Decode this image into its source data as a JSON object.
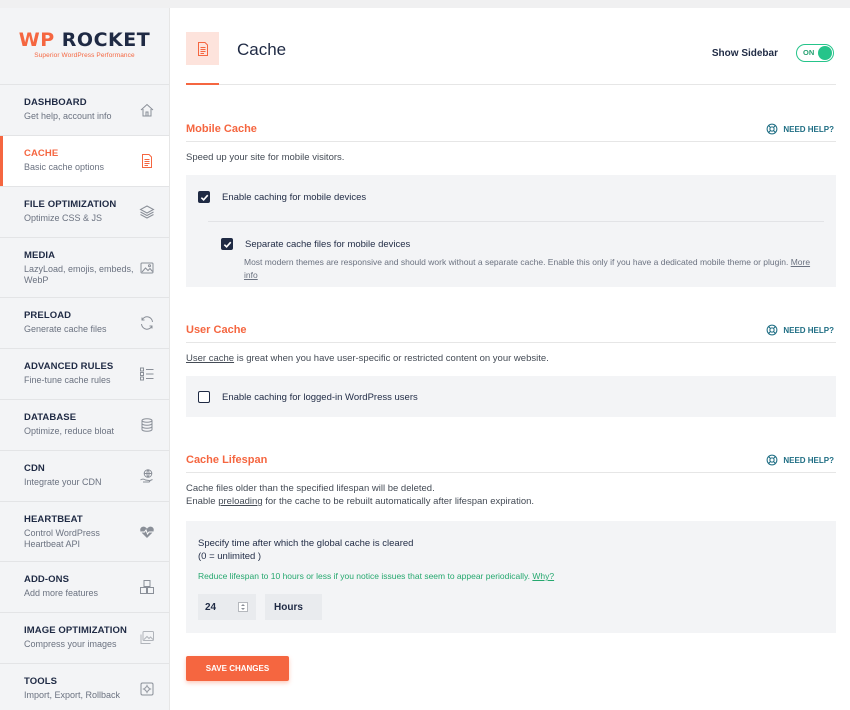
{
  "brand": {
    "logo_wp": "WP",
    "logo_rest": " ROCKET",
    "tagline": "Superior WordPress Performance"
  },
  "sidebar": {
    "items": [
      {
        "title": "DASHBOARD",
        "subtitle": "Get help, account info",
        "icon": "house-icon"
      },
      {
        "title": "CACHE",
        "subtitle": "Basic cache options",
        "icon": "document-icon"
      },
      {
        "title": "FILE OPTIMIZATION",
        "subtitle": "Optimize CSS & JS",
        "icon": "layers-icon"
      },
      {
        "title": "MEDIA",
        "subtitle": "LazyLoad, emojis, embeds, WebP",
        "icon": "image-icon"
      },
      {
        "title": "PRELOAD",
        "subtitle": "Generate cache files",
        "icon": "refresh-icon"
      },
      {
        "title": "ADVANCED RULES",
        "subtitle": "Fine-tune cache rules",
        "icon": "list-icon"
      },
      {
        "title": "DATABASE",
        "subtitle": "Optimize, reduce bloat",
        "icon": "database-icon"
      },
      {
        "title": "CDN",
        "subtitle": "Integrate your CDN",
        "icon": "cdn-icon"
      },
      {
        "title": "HEARTBEAT",
        "subtitle": "Control WordPress Heartbeat API",
        "icon": "heartbeat-icon"
      },
      {
        "title": "ADD-ONS",
        "subtitle": "Add more features",
        "icon": "boxes-icon"
      },
      {
        "title": "IMAGE OPTIMIZATION",
        "subtitle": "Compress your images",
        "icon": "images-icon"
      },
      {
        "title": "TOOLS",
        "subtitle": "Import, Export, Rollback",
        "icon": "tools-icon"
      }
    ],
    "active": "CACHE"
  },
  "header": {
    "title": "Cache",
    "show_sidebar_label": "Show Sidebar",
    "toggle_state": "ON"
  },
  "need_help_label": "NEED HELP?",
  "mobile_cache": {
    "title": "Mobile Cache",
    "description": "Speed up your site for mobile visitors.",
    "enable_label": "Enable caching for mobile devices",
    "enable_checked": true,
    "separate_label": "Separate cache files for mobile devices",
    "separate_checked": true,
    "separate_help": "Most modern themes are responsive and should work without a separate cache. Enable this only if you have a dedicated mobile theme or plugin.",
    "more_info": "More info"
  },
  "user_cache": {
    "title": "User Cache",
    "description_link": "User cache",
    "description_rest": " is great when you have user-specific or restricted content on your website.",
    "enable_label": "Enable caching for logged-in WordPress users",
    "enable_checked": false
  },
  "cache_lifespan": {
    "title": "Cache Lifespan",
    "description_line1": "Cache files older than the specified lifespan will be deleted.",
    "description_pre": "Enable ",
    "description_link": "preloading",
    "description_post": " for the cache to be rebuilt automatically after lifespan expiration.",
    "question": "Specify time after which the global cache is cleared",
    "question_note": "(0 = unlimited )",
    "warning": "Reduce lifespan to 10 hours or less if you notice issues that seem to appear periodically. ",
    "warning_link": "Why?",
    "value": "24",
    "unit": "Hours"
  },
  "save_label": "SAVE CHANGES",
  "colors": {
    "accent": "#f56640",
    "navy": "#1f2a44",
    "green": "#25c48a",
    "help_teal": "#1f6e84"
  }
}
